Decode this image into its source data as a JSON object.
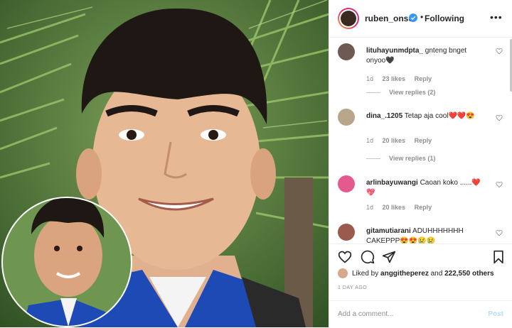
{
  "post": {
    "username": "ruben_onsu",
    "separator": "•",
    "follow_status": "Following",
    "more_label": "•••"
  },
  "comments": [
    {
      "user": "lituhayunmdpta_",
      "text": "gnteng bnget onyoo🖤",
      "time": "1d",
      "likes": "23 likes",
      "reply": "Reply",
      "view_replies": "View replies (2)"
    },
    {
      "user": "dina_.1205",
      "text": "Tetap aja cool❤️❤️😍",
      "time": "1d",
      "likes": "20 likes",
      "reply": "Reply",
      "view_replies": "View replies (1)"
    },
    {
      "user": "arlinbayuwangi",
      "text": "Caoan koko ......❤️💖",
      "time": "1d",
      "likes": "20 likes",
      "reply": "Reply"
    },
    {
      "user": "gitamutiarani",
      "text": "ADUHHHHHHH CAKEPPP😍😍😢😢"
    }
  ],
  "likes": {
    "prefix": "Liked by",
    "liker": "anggitheperez",
    "and": "and",
    "count": "222,550 others"
  },
  "time_ago": "1 DAY AGO",
  "add_comment": {
    "placeholder": "Add a comment...",
    "post_label": "Post"
  },
  "colors": {
    "accent_blue": "#0095f6",
    "post_disabled": "#b2dffc",
    "heart_red": "#ed4956"
  }
}
